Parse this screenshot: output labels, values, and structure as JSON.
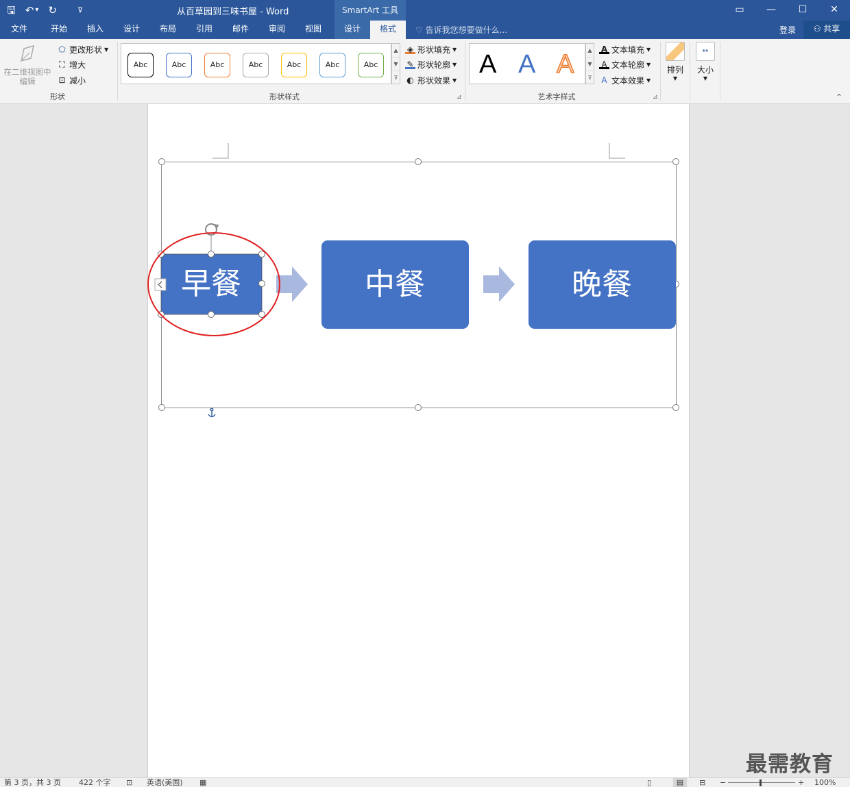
{
  "titlebar": {
    "doc_title": "从百草园到三味书屋 - Word",
    "context_title": "SmartArt 工具",
    "save_glyph": "🖫",
    "undo_glyph": "↶",
    "dropdown_glyph": "▾",
    "redo_glyph": "↻",
    "customize_glyph": "⊽",
    "restore_glyph": "▭",
    "minimize_glyph": "—",
    "maximize_glyph": "☐",
    "close_glyph": "✕"
  },
  "tabs": {
    "file": "文件",
    "home": "开始",
    "insert": "插入",
    "design": "设计",
    "layout": "布局",
    "references": "引用",
    "mailings": "邮件",
    "review": "审阅",
    "view": "视图",
    "smartart_design": "设计",
    "format": "格式",
    "tell_me": "告诉我您想要做什么...",
    "login": "登录",
    "share": "共享"
  },
  "ribbon": {
    "shapes_group": {
      "edit_2d": "在二维视图中编辑",
      "change_shape": "更改形状",
      "larger": "增大",
      "smaller": "减小",
      "label": "形状"
    },
    "shape_styles": {
      "items": [
        "Abc",
        "Abc",
        "Abc",
        "Abc",
        "Abc",
        "Abc",
        "Abc"
      ],
      "border_colors": [
        "#000000",
        "#4472c4",
        "#ed7d31",
        "#a5a5a5",
        "#ffc000",
        "#5b9bd5",
        "#70ad47"
      ],
      "fill": "形状填充",
      "outline": "形状轮廓",
      "effects": "形状效果",
      "label": "形状样式"
    },
    "wordart": {
      "letters": [
        "A",
        "A",
        "A"
      ],
      "fill": "文本填充",
      "outline": "文本轮廓",
      "effects": "文本效果",
      "label": "艺术字样式"
    },
    "arrange": "排列",
    "size": "大小"
  },
  "smartart": {
    "boxes": [
      "早餐",
      "中餐",
      "晚餐"
    ],
    "box_color": "#4472c4",
    "arrow_color": "#a9b8de",
    "highlight_color": "#e02020"
  },
  "status": {
    "page": "第 3 页，共 3 页",
    "words": "422 个字",
    "language": "英语(美国)",
    "zoom": "100%"
  },
  "watermark": "最需教育"
}
